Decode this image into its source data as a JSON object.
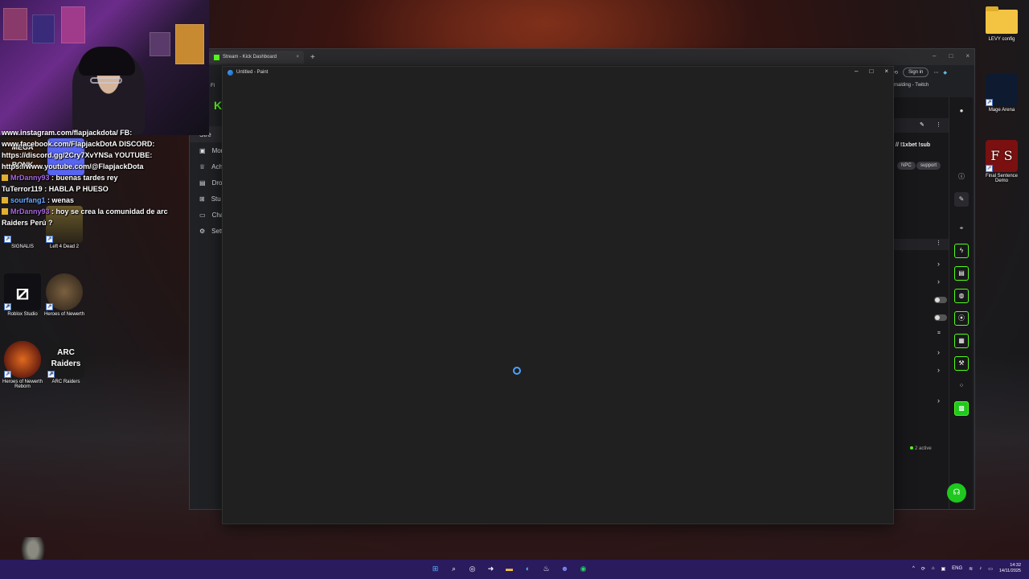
{
  "browser": {
    "tab_title": "Stream - Kick Dashboard",
    "new_tab": "+",
    "sign_in": "Sign in",
    "bookmark_right": "malding - Twitch",
    "bookmark_left": "Fl",
    "nav": [
      {
        "label": "Stre",
        "icon": "stream-icon"
      },
      {
        "label": "Mon",
        "icon": "monetize-icon"
      },
      {
        "label": "Ach",
        "icon": "achievements-icon"
      },
      {
        "label": "Dro",
        "icon": "drops-icon"
      },
      {
        "label": "Stu",
        "icon": "studio-icon"
      },
      {
        "label": "Cha",
        "icon": "channel-icon"
      },
      {
        "label": "Sett",
        "icon": "settings-icon"
      }
    ],
    "stream_title_fragment": "// !1xbet !sub",
    "tags": [
      "NPC",
      "support"
    ],
    "active_count": "2 active"
  },
  "paint": {
    "title": "Untitled - Paint"
  },
  "chat": [
    {
      "user": "",
      "text": "www.instagram.com/flapjackdota/ FB:"
    },
    {
      "user": "",
      "text": "www.facebook.com/FlapjackDotA DISCORD:"
    },
    {
      "user": "",
      "text": "https://discord.gg/2Cry7XvYNSa YOUTUBE:"
    },
    {
      "user": "",
      "text": "https://www.youtube.com/@FlapjackDota"
    },
    {
      "user": "MrDanny93",
      "text": "buenas tardes rey",
      "color": "purple",
      "badge": true
    },
    {
      "user": "TuTerror119",
      "text": "HABLA P HUESO",
      "color": "white",
      "badge": false
    },
    {
      "user": "sourfang1",
      "text": "wenas",
      "color": "blue",
      "badge": true
    },
    {
      "user": "MrDanny93",
      "text": "hoy se crea la comunidad de arc Raiders Perú ?",
      "color": "purple",
      "badge": true
    }
  ],
  "desktop_icons": [
    {
      "label": "SIGNALIS"
    },
    {
      "label": "Left 4 Dead 2"
    },
    {
      "label": "Roblox Studio"
    },
    {
      "label": "Heroes of Newerth"
    },
    {
      "label": "Heroes of Newerth Reborn"
    },
    {
      "label": "ARC Raiders"
    },
    {
      "label": "LEVY config"
    },
    {
      "label": "Mage Arena"
    },
    {
      "label": "Final Sentence Demo"
    }
  ],
  "overlay_texts": {
    "mega_bonk": "MEGA BONK",
    "arc_logo": "ARC Raiders",
    "fs_logo": "F S"
  },
  "taskbar": {
    "language": "ENG",
    "time": "14:32",
    "date": "14/11/2025"
  }
}
